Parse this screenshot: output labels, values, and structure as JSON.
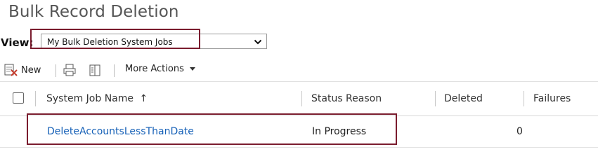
{
  "page": {
    "title": "Bulk Record Deletion"
  },
  "view": {
    "label": "View:",
    "selected": "My Bulk Deletion System Jobs",
    "chevron_icon": "chevron-down-icon"
  },
  "toolbar": {
    "new_label": "New",
    "more_actions_label": "More Actions",
    "icons": {
      "new": "new-record-icon",
      "print": "print-icon",
      "export": "export-icon",
      "dropdown": "caret-down-icon"
    }
  },
  "grid": {
    "columns": {
      "name": "System Job Name",
      "name_sort": "↑",
      "status": "Status Reason",
      "deleted": "Deleted",
      "failures": "Failures"
    },
    "rows": [
      {
        "name": "DeleteAccountsLessThanDate",
        "status": "In Progress",
        "deleted": "0",
        "failures": ""
      }
    ]
  },
  "colors": {
    "highlight": "#7a1c2e",
    "link": "#1560b7"
  }
}
